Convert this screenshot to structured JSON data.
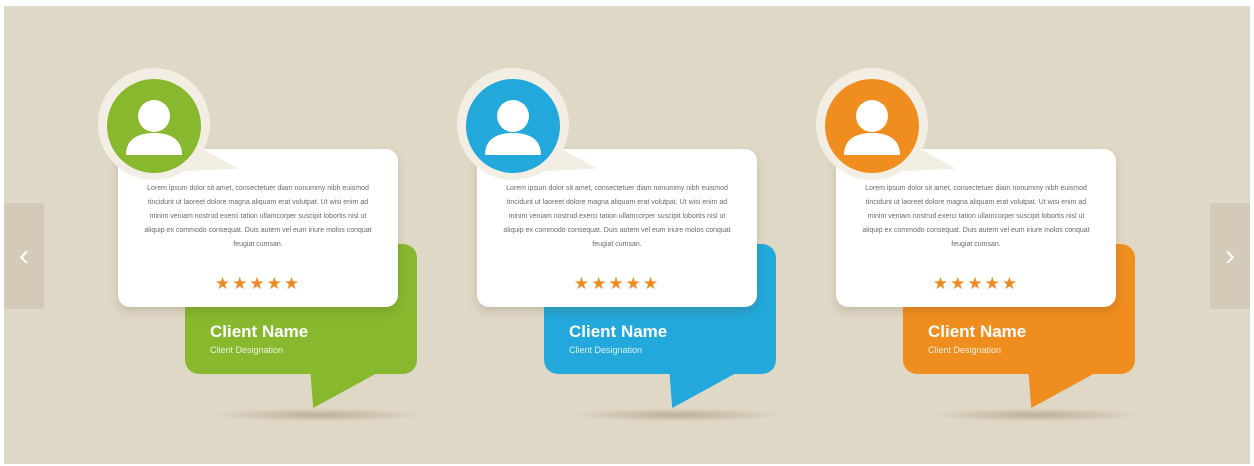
{
  "nav": {
    "prev": "‹",
    "next": "›"
  },
  "colors": {
    "background": "#e0d8c6",
    "green": "#87b82e",
    "blue": "#22a8db",
    "orange": "#f08d1f",
    "stars": "#ef8a22"
  },
  "testimonials": [
    {
      "color": "green",
      "icon": "user-icon",
      "text": "Lorem ipsum dolor sit amet, consectetuer diam nonummy nibh euismod tincidunt ut laoreet dolore magna aliquam erat volutpat. Ut wisi enim ad minim veniam nostrud exerci tation ullamcorper suscipit lobortis nisl ut aliquip ex commodo consequat. Duis autem vel eum iriure molos conquat feugiat cumsan.",
      "stars": "★★★★★",
      "rating": 5,
      "name": "Client Name",
      "designation": "Client Designation"
    },
    {
      "color": "blue",
      "icon": "user-icon",
      "text": "Lorem ipsum dolor sit amet, consectetuer diam nonummy nibh euismod tincidunt ut laoreet dolore magna aliquam erat volutpat. Ut wisi enim ad minim veniam nostrud exerci tation ullamcorper suscipit lobortis nisl ut aliquip ex commodo consequat. Duis autem vel eum iriure molos conquat feugiat cumsan.",
      "stars": "★★★★★",
      "rating": 5,
      "name": "Client Name",
      "designation": "Client Designation"
    },
    {
      "color": "orange",
      "icon": "user-icon",
      "text": "Lorem ipsum dolor sit amet, consectetuer diam nonummy nibh euismod tincidunt ut laoreet dolore magna aliquam erat volutpat. Ut wisi enim ad minim veniam nostrud exerci tation ullamcorper suscipit lobortis nisl ut aliquip ex commodo consequat. Duis autem vel eum iriure molos conquat feugiat cumsan.",
      "stars": "★★★★★",
      "rating": 5,
      "name": "Client Name",
      "designation": "Client Designation"
    }
  ]
}
